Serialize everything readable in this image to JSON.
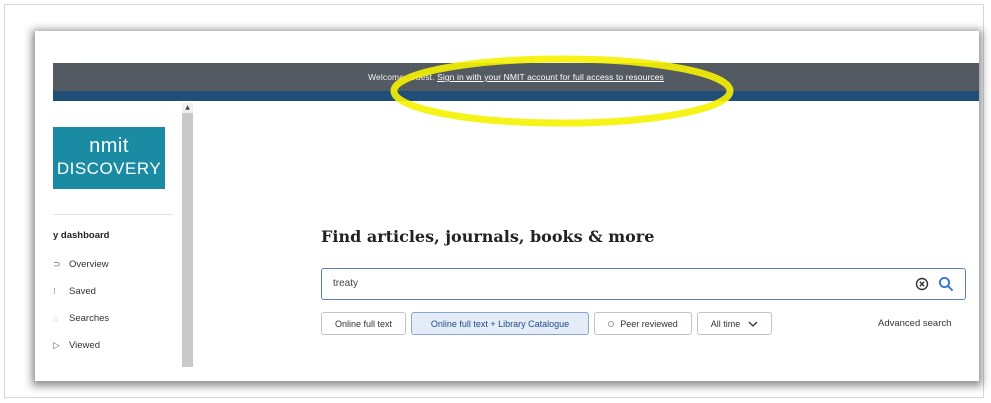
{
  "banner": {
    "welcome_text": "Welcome, Guest. ",
    "sign_in_link": "Sign in with your NMIT account for full access to resources"
  },
  "logo": {
    "line1": "nmit",
    "line2": "DISCOVERY"
  },
  "sidebar": {
    "title": "y dashboard",
    "items": [
      {
        "glyph": "⊃",
        "label": "Overview"
      },
      {
        "glyph": "⁝",
        "label": "Saved"
      },
      {
        "glyph": "◌",
        "label": "Searches"
      },
      {
        "glyph": "▷",
        "label": "Viewed"
      }
    ]
  },
  "main": {
    "headline": "Find articles, journals, books & more",
    "search": {
      "value": "treaty",
      "clear_icon": "clear-icon",
      "search_icon": "search-icon"
    },
    "filters": {
      "online_full_text": "Online full text",
      "online_full_text_catalogue": "Online full text + Library Catalogue",
      "peer_reviewed": "Peer reviewed",
      "date_range": "All time"
    },
    "advanced_search": "Advanced search"
  },
  "colors": {
    "banner": "#545a61",
    "strip": "#1f4e79",
    "logo": "#1a8ba3",
    "highlight": "#f5f200",
    "accent": "#2e6fd0"
  }
}
